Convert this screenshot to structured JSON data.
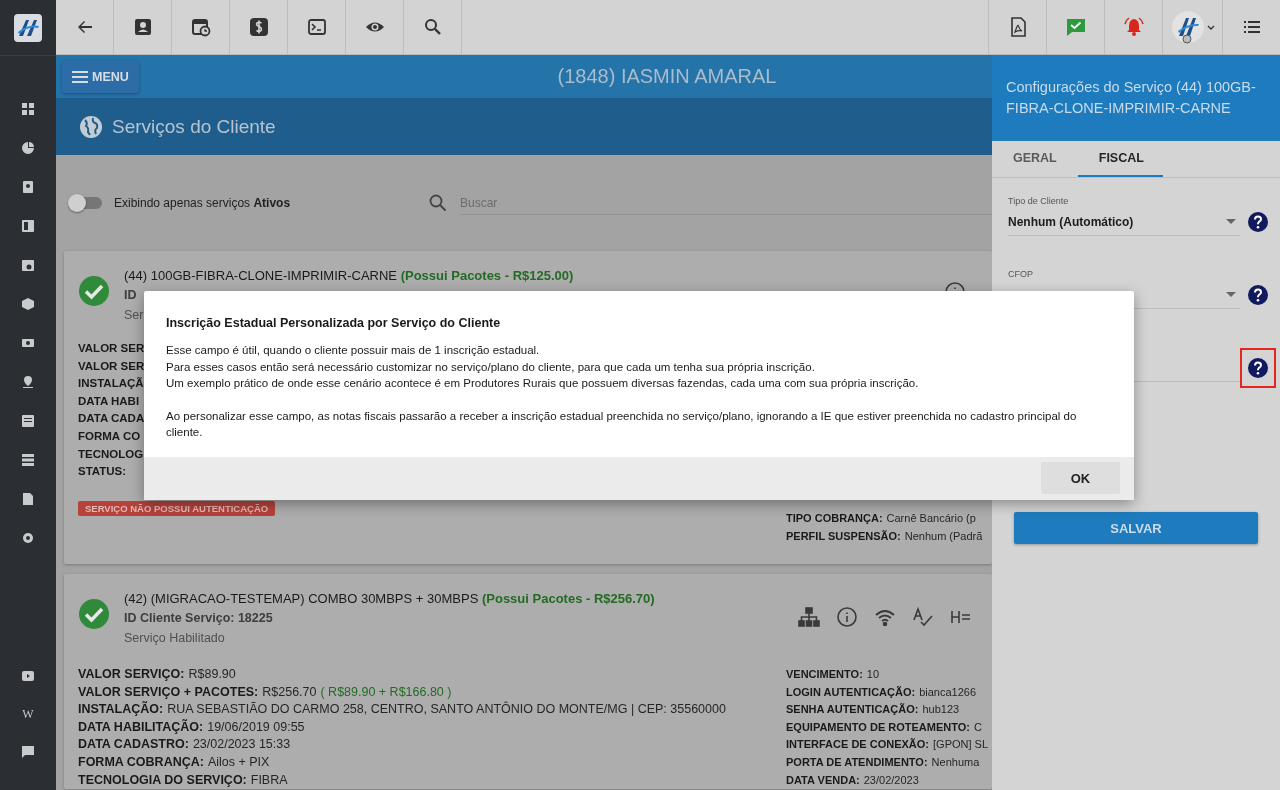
{
  "sidebar": {
    "items": [
      {
        "kind": "grid"
      },
      {
        "kind": "pie"
      },
      {
        "kind": "contact"
      },
      {
        "kind": "dashboard"
      },
      {
        "kind": "calendar"
      },
      {
        "kind": "box"
      },
      {
        "kind": "money"
      },
      {
        "kind": "pin"
      },
      {
        "kind": "list"
      },
      {
        "kind": "server"
      },
      {
        "kind": "document"
      },
      {
        "kind": "gear"
      }
    ],
    "bottom_items": [
      {
        "kind": "video"
      },
      {
        "kind": "letter",
        "label": "W"
      },
      {
        "kind": "chat"
      }
    ]
  },
  "toolbar": {
    "left": [
      {
        "kind": "back"
      },
      {
        "kind": "contact"
      },
      {
        "kind": "calendar"
      },
      {
        "kind": "dollar"
      },
      {
        "kind": "terminal"
      },
      {
        "kind": "eye"
      },
      {
        "kind": "search"
      }
    ],
    "right": [
      {
        "kind": "pdf"
      },
      {
        "kind": "chat"
      },
      {
        "kind": "bell"
      },
      {
        "kind": "avatar"
      },
      {
        "kind": "list"
      }
    ]
  },
  "header": {
    "menu_button": "MENU",
    "client_name": "(1848) IASMIN AMARAL",
    "section_title": "Serviços do Cliente"
  },
  "filter": {
    "toggle": {
      "on": false,
      "label": "Exibindo apenas serviços **Ativos**"
    },
    "search": {
      "placeholder": "Buscar"
    }
  },
  "services": [
    {
      "title": "(44) 100GB-FIBRA-CLONE-IMPRIMIR-CARNE",
      "package_info": "(Possui Pacotes - R$125.00)",
      "id_line": "ID",
      "status_line": "Ser",
      "actions": [
        {
          "kind": "info"
        }
      ],
      "left_fields": [
        {
          "label": "VALOR SER"
        },
        {
          "label": "VALOR SER"
        },
        {
          "label": "INSTALAÇÃ"
        },
        {
          "label": "DATA HABI"
        },
        {
          "label": "DATA CADA"
        },
        {
          "label": "FORMA CO"
        },
        {
          "label": "TECNOLOG"
        },
        {
          "label": "STATUS:"
        }
      ],
      "badge": "SERVIÇO NÃO POSSUI AUTENTICAÇÃO",
      "right_fields": [
        {
          "label": "TIPO COBRANÇA:",
          "value": "Carnê Bancário (p"
        },
        {
          "label": "PERFIL SUSPENSÃO:",
          "value": "Nenhum (Padrã"
        }
      ]
    },
    {
      "title": "(42) (MIGRACAO-TESTEMAP) COMBO 30MBPS + 30MBPS",
      "package_info": "(Possui Pacotes - R$256.70)",
      "id_line": "ID Cliente Serviço: 18225",
      "status_line": "Serviço Habilitado",
      "actions": [
        {
          "kind": "sitemap"
        },
        {
          "kind": "info"
        },
        {
          "kind": "wifi"
        },
        {
          "kind": "spellcheck"
        },
        {
          "kind": "heading"
        }
      ],
      "left_fields": [
        {
          "label": "VALOR SERVIÇO:",
          "value": "R$89.90"
        },
        {
          "label": "VALOR SERVIÇO + PACOTES:",
          "value": "R$256.70",
          "extra": "( R$89.90 + R$166.80 )"
        },
        {
          "label": "INSTALAÇÃO:",
          "value": "RUA SEBASTIÃO DO CARMO 258, CENTRO, SANTO ANTÔNIO DO MONTE/MG | CEP: 35560000"
        },
        {
          "label": "DATA HABILITAÇÃO:",
          "value": "19/06/2019 09:55"
        },
        {
          "label": "DATA CADASTRO:",
          "value": "23/02/2023 15:33"
        },
        {
          "label": "FORMA COBRANÇA:",
          "value": "Ailos + PIX"
        },
        {
          "label": "TECNOLOGIA DO SERVIÇO:",
          "value": "FIBRA"
        }
      ],
      "right_fields": [
        {
          "label": "VENCIMENTO:",
          "value": "10"
        },
        {
          "label": "LOGIN AUTENTICAÇÃO:",
          "value": "bianca1266"
        },
        {
          "label": "SENHA AUTENTICAÇÃO:",
          "value": "hub123"
        },
        {
          "label": "EQUIPAMENTO DE ROTEAMENTO:",
          "value": "C"
        },
        {
          "label": "INTERFACE DE CONEXÃO:",
          "value": "[GPON] SL"
        },
        {
          "label": "PORTA DE ATENDIMENTO:",
          "value": "Nenhuma"
        },
        {
          "label": "DATA VENDA:",
          "value": "23/02/2023"
        }
      ]
    }
  ],
  "panel": {
    "title": "Configurações do Serviço (44) 100GB-FIBRA-CLONE-IMPRIMIR-CARNE",
    "tabs": [
      {
        "label": "GERAL",
        "selected": false
      },
      {
        "label": "FISCAL",
        "selected": true
      }
    ],
    "fields": [
      {
        "kind": "select",
        "label": "Tipo de Cliente",
        "value": "Nenhum (Automático)",
        "highlighted": false
      },
      {
        "kind": "select",
        "label": "CFOP",
        "highlighted": false
      },
      {
        "kind": "text",
        "highlighted": true
      }
    ],
    "save_button": "SALVAR"
  },
  "dialog": {
    "title": "Inscrição Estadual Personalizada por Serviço do Cliente",
    "paragraphs": [
      "Esse campo é útil, quando o cliente possuir mais de 1 inscrição estadual.\nPara esses casos então será necessário customizar no serviço/plano do cliente, para que cada um tenha sua própria inscrição.\nUm exemplo prático de onde esse cenário acontece é em Produtores Rurais que possuem diversas fazendas, cada uma com sua própria inscrição.",
      "Ao personalizar esse campo, as notas fiscais passarão a receber a inscrição estadual preenchida no serviço/plano, ignorando a IE que estiver preenchida no cadastro principal do cliente."
    ],
    "ok_button": "OK"
  }
}
